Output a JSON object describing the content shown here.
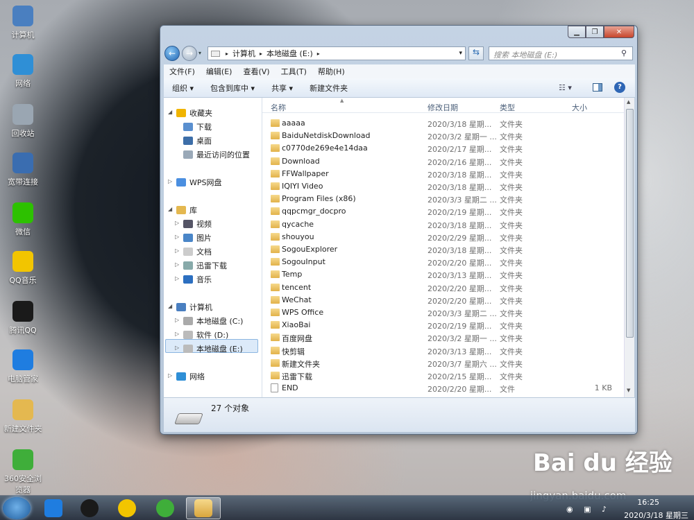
{
  "desktop_icons": [
    {
      "label": "计算机",
      "color": "#4a7fc0",
      "icon": "computer-icon"
    },
    {
      "label": "网络",
      "color": "#2f8fd6",
      "icon": "network-icon"
    },
    {
      "label": "回收站",
      "color": "#9aa6b2",
      "icon": "recycle-bin-icon"
    },
    {
      "label": "宽带连接",
      "color": "#3a6db0",
      "icon": "broadband-icon"
    },
    {
      "label": "微信",
      "color": "#2dc100",
      "icon": "wechat-icon"
    },
    {
      "label": "QQ音乐",
      "color": "#f2c500",
      "icon": "qq-music-icon"
    },
    {
      "label": "腾讯QQ",
      "color": "#1a1a1a",
      "icon": "qq-icon"
    },
    {
      "label": "电脑管家",
      "color": "#1f7de0",
      "icon": "pc-manager-icon"
    },
    {
      "label": "新建文件夹",
      "color": "#e4b850",
      "icon": "folder-icon"
    },
    {
      "label": "360安全浏览器",
      "color": "#3fae3a",
      "icon": "browser-360-icon"
    }
  ],
  "window": {
    "address": {
      "root": "计算机",
      "drive": "本地磁盘 (E:)"
    },
    "search_placeholder": "搜索 本地磁盘 (E:)",
    "menu": [
      "文件(F)",
      "编辑(E)",
      "查看(V)",
      "工具(T)",
      "帮助(H)"
    ],
    "commands": [
      "组织 ▾",
      "包含到库中 ▾",
      "共享 ▾",
      "新建文件夹"
    ],
    "nav": {
      "favorites": {
        "label": "收藏夹",
        "items": [
          "下载",
          "桌面",
          "最近访问的位置"
        ]
      },
      "wps": "WPS网盘",
      "library": {
        "label": "库",
        "items": [
          "视频",
          "图片",
          "文档",
          "迅雷下载",
          "音乐"
        ]
      },
      "computer": {
        "label": "计算机",
        "items": [
          "本地磁盘 (C:)",
          "软件 (D:)",
          "本地磁盘 (E:)"
        ]
      },
      "network": "网络"
    },
    "columns": {
      "name": "名称",
      "date": "修改日期",
      "type": "类型",
      "size": "大小"
    },
    "files": [
      {
        "name": "aaaaa",
        "date": "2020/3/18 星期...",
        "type": "文件夹",
        "size": ""
      },
      {
        "name": "BaiduNetdiskDownload",
        "date": "2020/3/2 星期一 ...",
        "type": "文件夹",
        "size": ""
      },
      {
        "name": "c0770de269e4e14daa",
        "date": "2020/2/17 星期...",
        "type": "文件夹",
        "size": ""
      },
      {
        "name": "Download",
        "date": "2020/2/16 星期...",
        "type": "文件夹",
        "size": ""
      },
      {
        "name": "FFWallpaper",
        "date": "2020/3/18 星期...",
        "type": "文件夹",
        "size": ""
      },
      {
        "name": "IQIYI Video",
        "date": "2020/3/18 星期...",
        "type": "文件夹",
        "size": ""
      },
      {
        "name": "Program Files (x86)",
        "date": "2020/3/3 星期二 ...",
        "type": "文件夹",
        "size": ""
      },
      {
        "name": "qqpcmgr_docpro",
        "date": "2020/2/19 星期...",
        "type": "文件夹",
        "size": ""
      },
      {
        "name": "qycache",
        "date": "2020/3/18 星期...",
        "type": "文件夹",
        "size": ""
      },
      {
        "name": "shouyou",
        "date": "2020/2/29 星期...",
        "type": "文件夹",
        "size": ""
      },
      {
        "name": "SogouExplorer",
        "date": "2020/3/18 星期...",
        "type": "文件夹",
        "size": ""
      },
      {
        "name": "SogouInput",
        "date": "2020/2/20 星期...",
        "type": "文件夹",
        "size": ""
      },
      {
        "name": "Temp",
        "date": "2020/3/13 星期...",
        "type": "文件夹",
        "size": ""
      },
      {
        "name": "tencent",
        "date": "2020/2/20 星期...",
        "type": "文件夹",
        "size": ""
      },
      {
        "name": "WeChat",
        "date": "2020/2/20 星期...",
        "type": "文件夹",
        "size": ""
      },
      {
        "name": "WPS Office",
        "date": "2020/3/3 星期二 ...",
        "type": "文件夹",
        "size": ""
      },
      {
        "name": "XiaoBai",
        "date": "2020/2/19 星期...",
        "type": "文件夹",
        "size": ""
      },
      {
        "name": "百度网盘",
        "date": "2020/3/2 星期一 ...",
        "type": "文件夹",
        "size": ""
      },
      {
        "name": "快剪辑",
        "date": "2020/3/13 星期...",
        "type": "文件夹",
        "size": ""
      },
      {
        "name": "新建文件夹",
        "date": "2020/3/7 星期六 ...",
        "type": "文件夹",
        "size": ""
      },
      {
        "name": "迅雷下载",
        "date": "2020/2/15 星期...",
        "type": "文件夹",
        "size": ""
      },
      {
        "name": "END",
        "date": "2020/2/20 星期...",
        "type": "文件",
        "size": "1 KB",
        "is_file": true
      }
    ],
    "status": "27 个对象"
  },
  "tray": {
    "time": "16:25",
    "date": "2020/3/18 星期三"
  },
  "watermark": {
    "brand": "Bai du 经验",
    "url": "jingyan.baidu.com"
  }
}
